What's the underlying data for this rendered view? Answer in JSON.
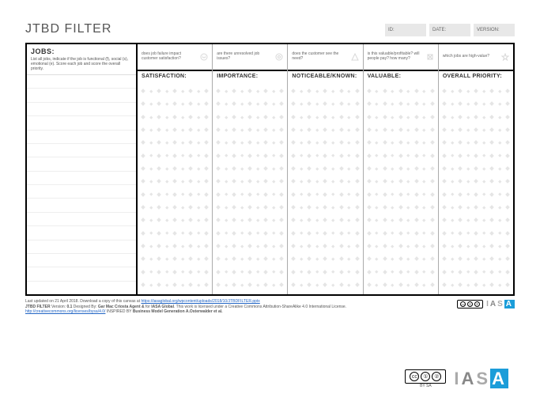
{
  "title": "JTBD FILTER",
  "meta": {
    "id_label": "ID:",
    "date_label": "DATE:",
    "version_label": "VERSION:"
  },
  "jobs": {
    "heading": "JOBS:",
    "instruction": "List all jobs, indicate if the job is functional (f), social (s), emotional (e). Score each job and score the overall priority."
  },
  "columns": [
    {
      "question": "does job failure impact customer satisfaction?",
      "label": "SATISFACTION:"
    },
    {
      "question": "are there unresolved job issues?",
      "label": "IMPORTANCE:"
    },
    {
      "question": "does the customer see the need?",
      "label": "NOTICEABLE/KNOWN:"
    },
    {
      "question": "is this valuable/profitable? will people pay? how many?",
      "label": "VALUABLE:"
    },
    {
      "question": "which jobs are high-value?",
      "label": "OVERALL PRIORITY:"
    }
  ],
  "footer": {
    "line1a": "Last updated on 21 April 2018. Download a copy of this canvas at ",
    "link1": "https://iasaglobal.org/wpcontent/uploads/2018/10/JTBDFILTER.pptx",
    "line2a": "JTBD FILTER",
    "line2b": " Version: ",
    "line2v": "0.1",
    "line2c": " Designed By: ",
    "line2d": "Gar Mac Criosta Agent &",
    "line2e": " for ",
    "line2f": "IASA Global",
    "line2g": ". This work is licensed under a Creative Commons Attribution-ShareAlike 4.0 International License.",
    "link2": "http://creativecommons.org/licenses/bysa/4.0/",
    "line3a": " INSPIRED BY ",
    "line3b": "Business Model Generation  A.Osterwalder et al."
  },
  "iasa": {
    "t": "IASA"
  },
  "cc": {
    "by_sa": "BY   SA"
  }
}
